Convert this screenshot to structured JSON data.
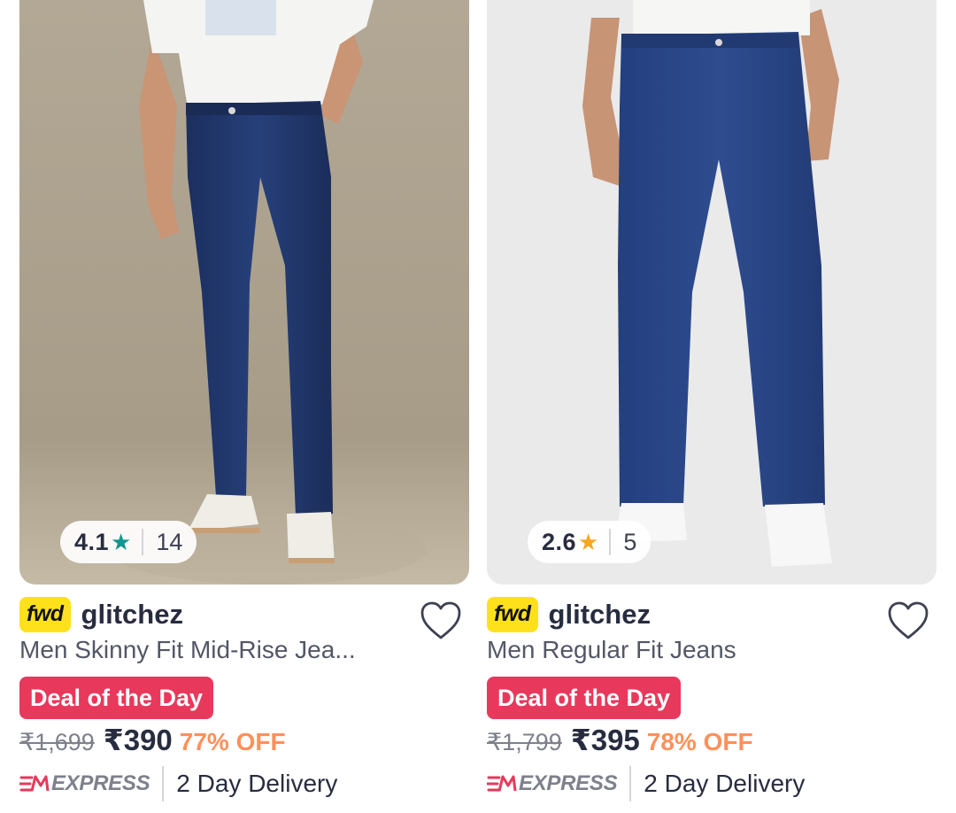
{
  "products": [
    {
      "rating": "4.1",
      "rating_count": "14",
      "star_color": "#14958f",
      "badge": "fwd",
      "brand": "glitchez",
      "title": "Men Skinny Fit Mid-Rise Jea...",
      "deal": "Deal of the Day",
      "mrp": "₹1,699",
      "price": "₹390",
      "discount": "77% OFF",
      "express": "EXPRESS",
      "delivery": "2 Day Delivery"
    },
    {
      "rating": "2.6",
      "rating_count": "5",
      "star_color": "#f5a623",
      "badge": "fwd",
      "brand": "glitchez",
      "title": "Men Regular Fit Jeans",
      "deal": "Deal of the Day",
      "mrp": "₹1,799",
      "price": "₹395",
      "discount": "78% OFF",
      "express": "EXPRESS",
      "delivery": "2 Day Delivery"
    }
  ]
}
